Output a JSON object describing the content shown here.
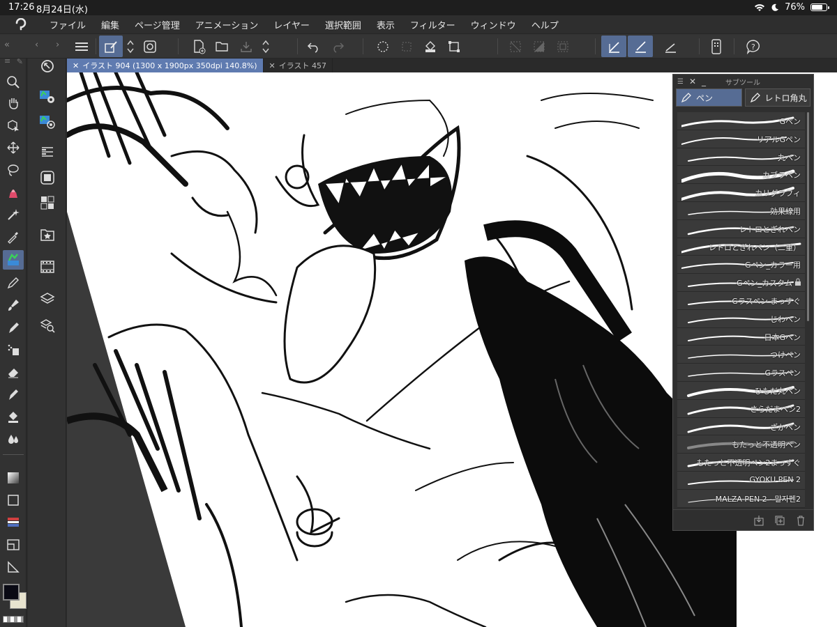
{
  "status": {
    "time": "17:26",
    "date": "8月24日(水)",
    "battery": "76%",
    "battery_level": 0.76
  },
  "menu": [
    "ファイル",
    "編集",
    "ページ管理",
    "アニメーション",
    "レイヤー",
    "選択範囲",
    "表示",
    "フィルター",
    "ウィンドウ",
    "ヘルプ"
  ],
  "tabs": [
    {
      "label": "イラスト 904 (1300 x 1900px 350dpi 140.8%)",
      "active": true
    },
    {
      "label": "イラスト 457",
      "active": false
    }
  ],
  "subtool": {
    "title": "サブツール",
    "groups": [
      "ペン",
      "レトロ角丸"
    ],
    "brushes": [
      "Gペン",
      "リアルGペン",
      "丸ペン",
      "カブラペン",
      "カリグラフィ",
      "効果線用",
      "レトロとぎれペン",
      "レトロとぎれペン（二重）",
      "Gペン_カラー用",
      "Gペン_カスタム",
      "Gラスペン まっすぐ",
      "じわペン",
      "日本Gペン",
      "つけペン",
      "Gラスペン",
      "ひもだ丸ペン",
      "さらだまペン2",
      "ざかペン",
      "もたっと不透明ペン",
      "もたっと不透明ペン2まっすぐ",
      "GYOKU PEN 2",
      "MALZA PEN 2 - 말자펜2"
    ]
  },
  "colors": {
    "accent": "#566c94",
    "tab_active": "#5f7bb0",
    "panel": "#2f2f2f",
    "main_color": "#0a0a14",
    "sub_color": "#e8e4cf"
  }
}
